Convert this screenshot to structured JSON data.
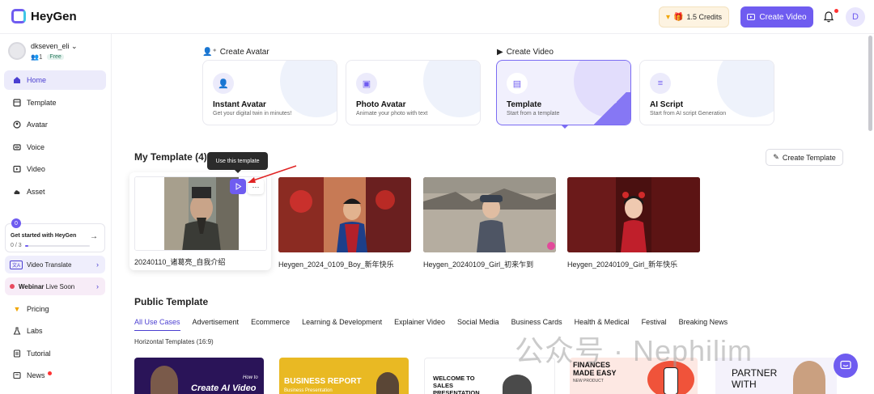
{
  "app": {
    "name": "HeyGen"
  },
  "topbar": {
    "credits": "1.5 Credits",
    "create_video": "Create Video",
    "avatar_initial": "D"
  },
  "user": {
    "name": "dkseven_eli",
    "members": "1",
    "plan": "Free"
  },
  "sidebar": {
    "items": [
      {
        "label": "Home",
        "icon": "home-icon",
        "active": true
      },
      {
        "label": "Template",
        "icon": "template-icon"
      },
      {
        "label": "Avatar",
        "icon": "avatar-icon"
      },
      {
        "label": "Voice",
        "icon": "voice-icon"
      },
      {
        "label": "Video",
        "icon": "video-icon"
      },
      {
        "label": "Asset",
        "icon": "cloud-icon"
      }
    ],
    "get_started": {
      "badge": "0",
      "title": "Get started with HeyGen",
      "count": "0 / 3",
      "progress": 0.05
    },
    "video_translate": {
      "label": "Video Translate"
    },
    "webinar": {
      "label": "Webinar",
      "suffix": "Live Soon"
    },
    "bottom_items": [
      {
        "label": "Pricing",
        "icon": "pricing-icon"
      },
      {
        "label": "Labs",
        "icon": "labs-icon"
      },
      {
        "label": "Tutorial",
        "icon": "tutorial-icon"
      },
      {
        "label": "News",
        "icon": "news-icon"
      }
    ]
  },
  "create_avatar": {
    "label": "Create Avatar",
    "cards": [
      {
        "title": "Instant Avatar",
        "sub": "Get your digital twin in minutes!"
      },
      {
        "title": "Photo Avatar",
        "sub": "Animate your photo with text"
      }
    ]
  },
  "create_video": {
    "label": "Create Video",
    "cards": [
      {
        "title": "Template",
        "sub": "Start from a template",
        "selected": true
      },
      {
        "title": "AI Script",
        "sub": "Start from AI script Generation"
      }
    ]
  },
  "my_template": {
    "title": "My Template (4)",
    "create_button": "Create Template",
    "tooltip": "Use this template",
    "items": [
      {
        "name": "20240110_诸葛亮_自我介绍"
      },
      {
        "name": "Heygen_2024_0109_Boy_新年快乐"
      },
      {
        "name": "Heygen_20240109_Girl_初来乍到"
      },
      {
        "name": "Heygen_20240109_Girl_新年快乐"
      }
    ]
  },
  "public_template": {
    "title": "Public Template",
    "tabs": [
      "All Use Cases",
      "Advertisement",
      "Ecommerce",
      "Learning & Development",
      "Explainer Video",
      "Social Media",
      "Business Cards",
      "Health & Medical",
      "Festival",
      "Breaking News"
    ],
    "active_tab": "All Use Cases",
    "sub_label": "Horizontal Templates (16:9)",
    "cards": [
      {
        "small": "How to",
        "big": "Create AI Video"
      },
      {
        "big": "BUSINESS REPORT",
        "small": "Business Presentation"
      },
      {
        "big": "WELCOME TO SALES PRESENTATION"
      },
      {
        "big": "FINANCES MADE EASY",
        "small": "NEW PRODUCT"
      },
      {
        "big": "PARTNER WITH"
      }
    ]
  },
  "watermark": "公众号 · Nephilim",
  "colors": {
    "accent": "#6f5cf0",
    "active_bg": "#ecebfb"
  }
}
